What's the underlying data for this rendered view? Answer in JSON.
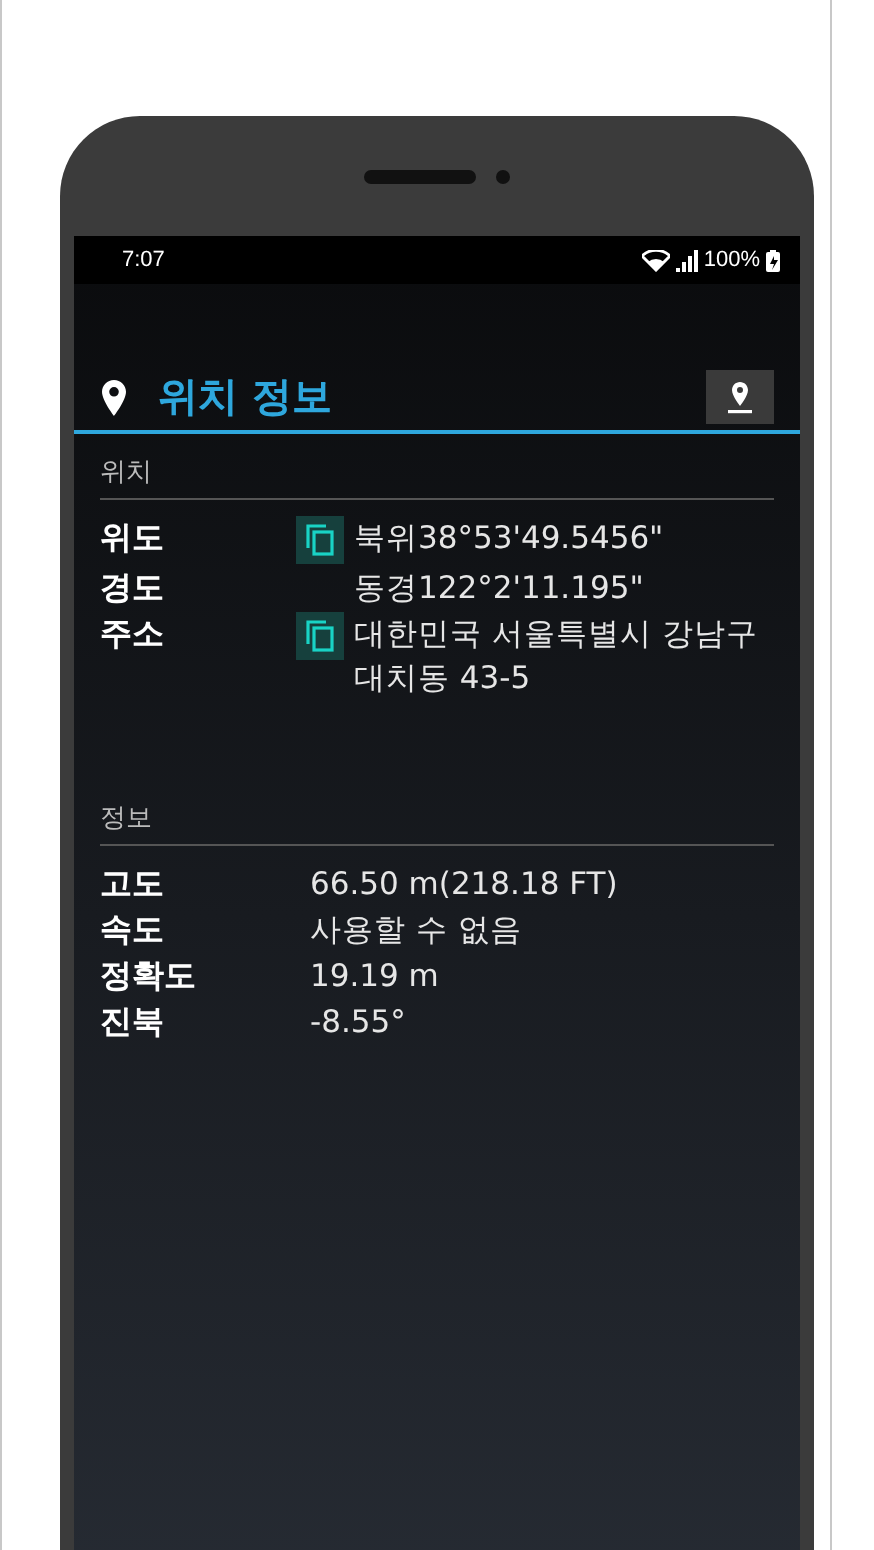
{
  "status_bar": {
    "time": "7:07",
    "battery": "100%"
  },
  "header": {
    "title": "위치 정보"
  },
  "sections": [
    {
      "title": "위치",
      "kind": "copyable",
      "rows": [
        {
          "label": "위도",
          "value": "북위38°53'49.5456\"",
          "copy": true
        },
        {
          "label": "경도",
          "value": "동경122°2'11.195\"",
          "copy": false
        },
        {
          "label": "주소",
          "value": "대한민국 서울특별시 강남구 대치동 43-5",
          "copy": true
        }
      ]
    },
    {
      "title": "정보",
      "kind": "plain",
      "rows": [
        {
          "label": "고도",
          "value": "66.50 m(218.18 FT)"
        },
        {
          "label": "속도",
          "value": "사용할 수 없음"
        },
        {
          "label": "정확도",
          "value": "19.19 m"
        },
        {
          "label": "진북",
          "value": "-8.55°"
        }
      ]
    }
  ]
}
